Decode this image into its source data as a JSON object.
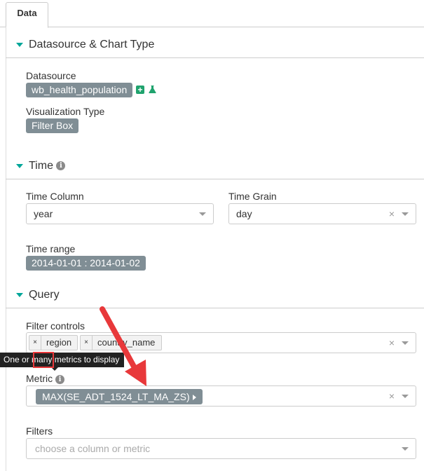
{
  "tab": {
    "label": "Data"
  },
  "sections": {
    "datasource": {
      "title": "Datasource & Chart Type",
      "datasource_label": "Datasource",
      "datasource_value": "wb_health_population",
      "viz_label": "Visualization Type",
      "viz_value": "Filter Box"
    },
    "time": {
      "title": "Time",
      "time_column_label": "Time Column",
      "time_column_value": "year",
      "time_grain_label": "Time Grain",
      "time_grain_value": "day",
      "time_range_label": "Time range",
      "time_range_value": "2014-01-01 : 2014-01-02"
    },
    "query": {
      "title": "Query",
      "filter_controls_label": "Filter controls",
      "filter_controls_tags": [
        "region",
        "country_name"
      ],
      "tooltip": "One or many metrics to display",
      "metric_label": "Metric",
      "metric_value": "MAX(SE_ADT_1524_LT_MA_ZS)",
      "filters_label": "Filters",
      "filters_placeholder": "choose a column or metric"
    }
  },
  "icons": {
    "clear": "×",
    "remove_tag": "×",
    "info": "i",
    "add": "+"
  },
  "colors": {
    "accent": "#00a699",
    "pill": "#808e95",
    "annotation": "#e8383a",
    "add_button": "#20a36e"
  }
}
